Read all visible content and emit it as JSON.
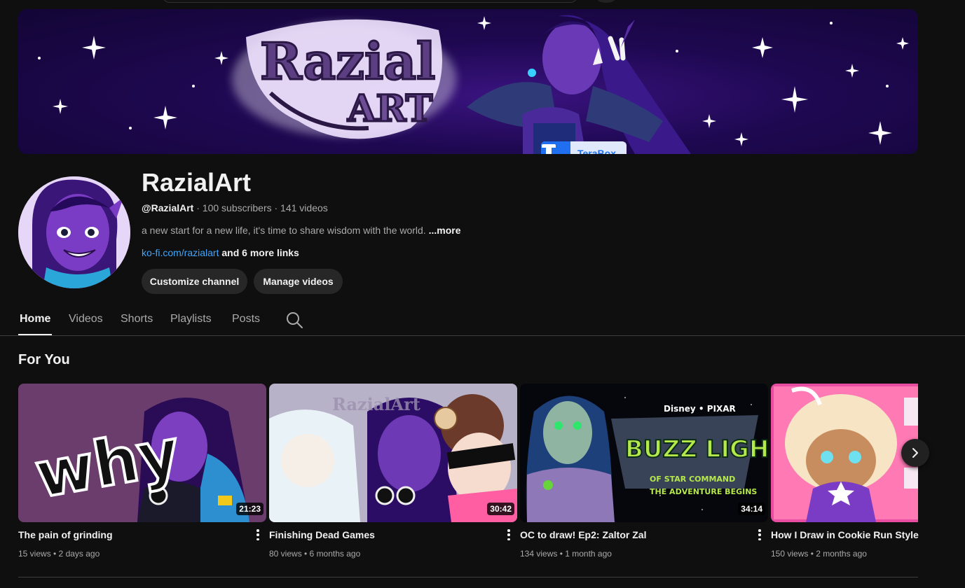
{
  "banner": {
    "title_art": "Razial Art",
    "sponsor_badge": {
      "label": "TeraBox",
      "icon": "terabox-icon",
      "color": "#1f6ff0"
    }
  },
  "channel": {
    "name": "RazialArt",
    "handle": "@RazialArt",
    "meta": " · 100 subscribers · 141 videos",
    "description": "a new start for a new life, it's time to share wisdom with the world. ",
    "description_more": "...more",
    "link": "ko-fi.com/razialart",
    "more_links": " and 6 more links",
    "buttons": {
      "customize": "Customize channel",
      "manage": "Manage videos"
    }
  },
  "tabs": [
    {
      "label": "Home",
      "active": true
    },
    {
      "label": "Videos",
      "active": false
    },
    {
      "label": "Shorts",
      "active": false
    },
    {
      "label": "Playlists",
      "active": false
    },
    {
      "label": "Posts",
      "active": false
    }
  ],
  "section": {
    "title": "For You"
  },
  "videos": [
    {
      "title": "The pain of grinding",
      "stats": "15 views • 2 days ago",
      "duration": "21:23",
      "thumb_text": "why"
    },
    {
      "title": "Finishing Dead Games",
      "stats": "80 views • 6 months ago",
      "duration": "30:42",
      "thumb_text": "RazialArt"
    },
    {
      "title": "OC to draw! Ep2: Zaltor Zal",
      "stats": "134 views • 1 month ago",
      "duration": "34:14",
      "thumb_text": "BUZZ LIGHTYEAR"
    },
    {
      "title": "How I Draw in Cookie Run Style",
      "stats": "150 views • 2 months ago",
      "duration": "",
      "thumb_text": ""
    }
  ],
  "icons": {
    "search": "search-icon",
    "next": "chevron-right-icon",
    "menu": "more-vert-icon"
  },
  "colors": {
    "background": "#0f0f0f",
    "link": "#3ea6ff",
    "button": "#272727",
    "banner": "#1e0850"
  }
}
